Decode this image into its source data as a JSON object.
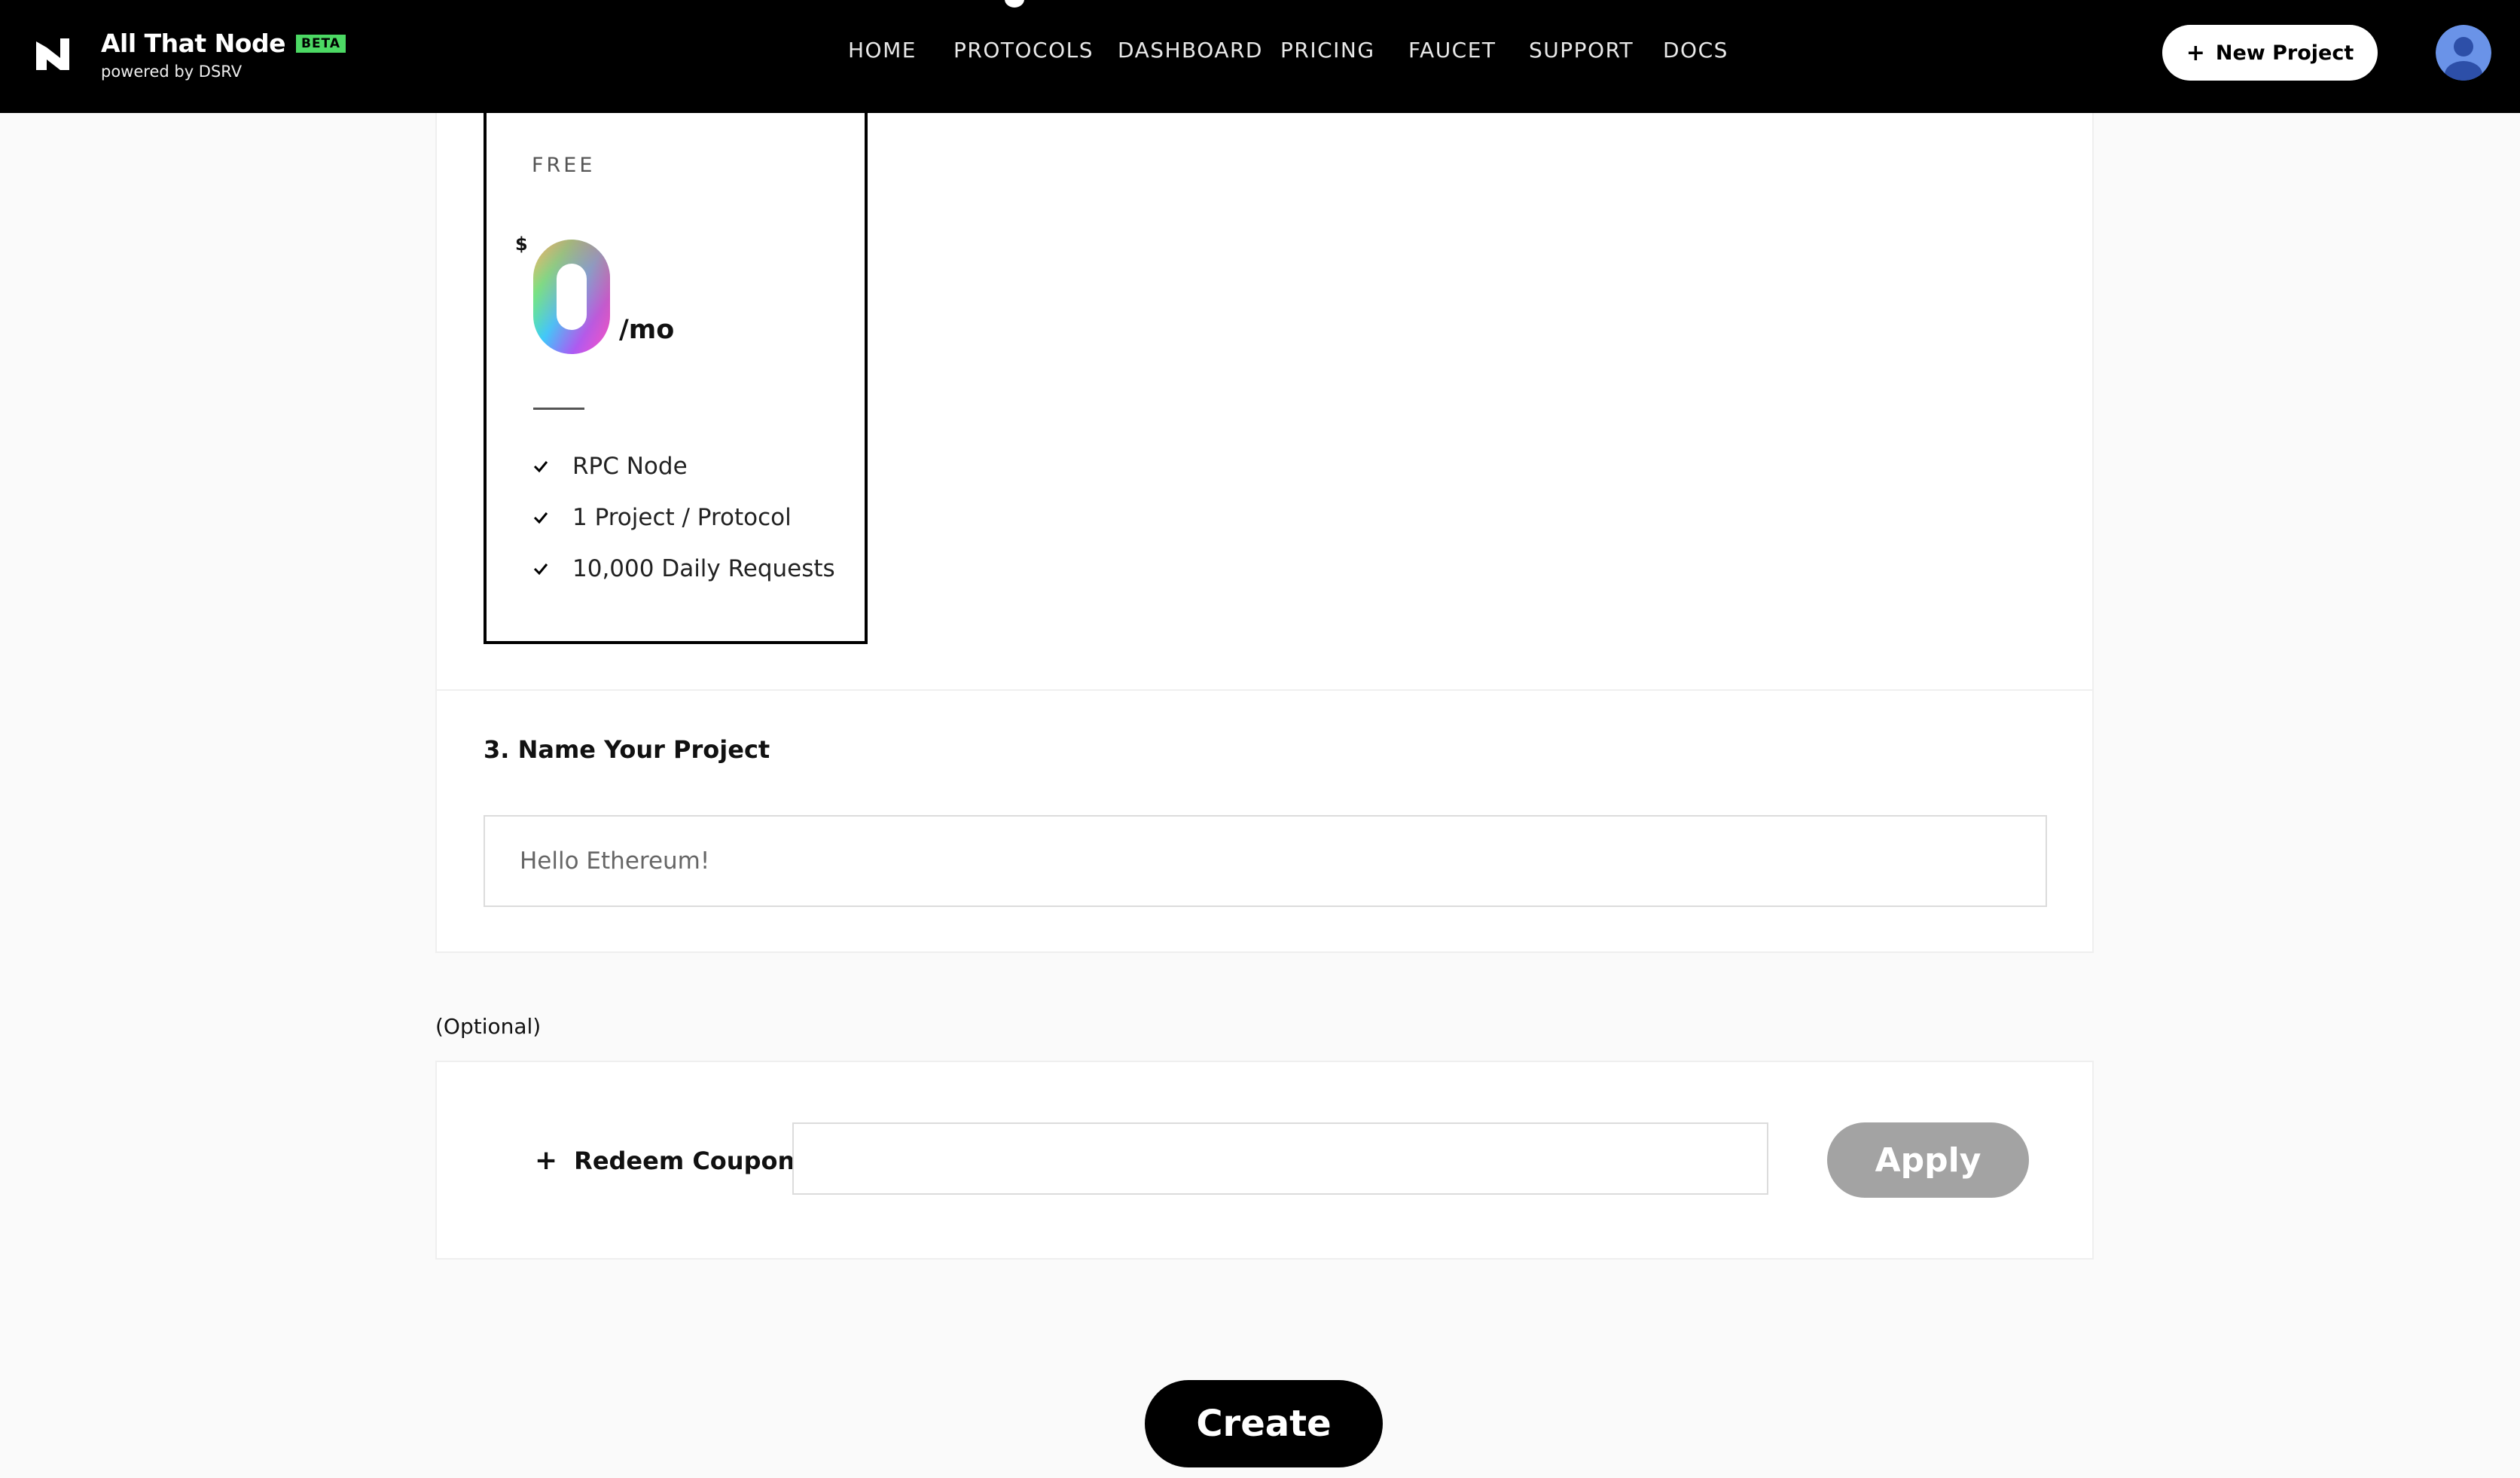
{
  "header": {
    "brand_name": "All That Node",
    "beta_badge": "BETA",
    "brand_sub": "powered by DSRV",
    "nav": [
      {
        "label": "HOME"
      },
      {
        "label": "PROTOCOLS"
      },
      {
        "label": "DASHBOARD"
      },
      {
        "label": "PRICING"
      },
      {
        "label": "FAUCET"
      },
      {
        "label": "SUPPORT"
      },
      {
        "label": "DOCS"
      }
    ],
    "new_project_label": "New Project",
    "icons": {
      "logo": "all-that-node-logo-icon",
      "plus": "plus-icon",
      "avatar": "user-avatar-icon"
    }
  },
  "plan": {
    "name": "FREE",
    "currency": "$",
    "price": "0",
    "period": "/mo",
    "features": [
      {
        "label": "RPC Node"
      },
      {
        "label": "1 Project / Protocol"
      },
      {
        "label": "10,000 Daily Requests"
      }
    ],
    "check_icon": "check-icon",
    "price_gradient": [
      "#ff4fd8",
      "#9b5cff",
      "#2fd3ff",
      "#5dff7a",
      "#ffd24d",
      "#ff5b5b"
    ]
  },
  "project": {
    "section_title": "3. Name Your Project",
    "name_placeholder": "Hello Ethereum!",
    "name_value": ""
  },
  "coupon": {
    "optional_label": "(Optional)",
    "redeem_label": "Redeem Coupon",
    "coupon_value": "",
    "apply_label": "Apply"
  },
  "actions": {
    "create_label": "Create"
  },
  "colors": {
    "header_bg": "#000000",
    "beta_badge": "#4cd964",
    "apply_disabled": "#a3a3a3",
    "page_bg": "#fafafa"
  }
}
